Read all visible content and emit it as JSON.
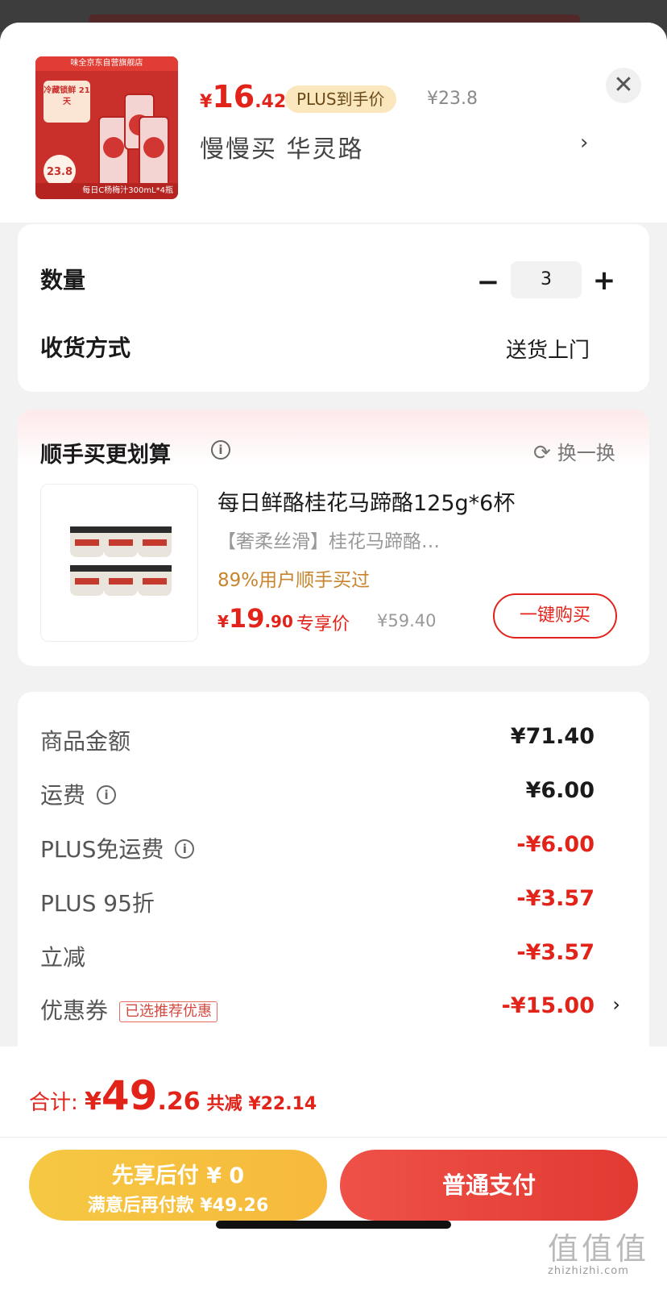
{
  "header": {
    "store_name": "味全京东自营旗舰店",
    "thumb_badge": "冷藏锁鲜 21天",
    "thumb_price": "23.8",
    "thumb_caption": "每日C杨梅汁300mL*4瓶",
    "price_yen": "¥",
    "price_int": "16",
    "price_dec": ".42",
    "plus_tag": "PLUS到手价",
    "original_price": "¥23.8",
    "spec": "慢慢买  华灵路",
    "spec_arrow": "›",
    "close": "✕"
  },
  "quantity": {
    "label": "数量",
    "minus": "−",
    "value": "3",
    "plus": "+"
  },
  "delivery": {
    "label": "收货方式",
    "value": "送货上门"
  },
  "upsell": {
    "title": "顺手买更划算",
    "info": "i",
    "swap_icon": "⟳",
    "swap_label": "换一换",
    "product_name": "每日鲜酪桂花马蹄酪125g*6杯",
    "product_sub": "【奢柔丝滑】桂花马蹄酪…",
    "product_pct": "89%用户顺手买过",
    "price_yen": "¥",
    "price_int": "19",
    "price_dec": ".90",
    "exclusive": "专享价",
    "original_price": "¥59.40",
    "buy_button": "一键购买"
  },
  "summary": {
    "rows": [
      {
        "label": "商品金额",
        "value": "¥71.40"
      },
      {
        "label": "运费",
        "value": "¥6.00"
      },
      {
        "label": "PLUS免运费",
        "value": "-¥6.00"
      },
      {
        "label": "PLUS 95折",
        "value": "-¥3.57"
      },
      {
        "label": "立减",
        "value": "-¥3.57"
      },
      {
        "label": "优惠券",
        "tag": "已选推荐优惠",
        "value": "-¥15.00",
        "arrow": "›"
      }
    ]
  },
  "footer": {
    "total_label": "合计: ",
    "total_yen": "¥",
    "total_int": "49",
    "total_dec": ".26",
    "total_reduce": "共减 ¥22.14",
    "later_line1": "先享后付 ¥ 0",
    "later_line2": "满意后再付款 ¥49.26",
    "pay_button": "普通支付"
  },
  "watermark": {
    "glyphs": "值值值",
    "site": "zhizhizhi.com"
  },
  "colors": {
    "accent_red": "#e2231a",
    "plus_gold": "#fbe7bd",
    "later_button": "#f5c842"
  }
}
